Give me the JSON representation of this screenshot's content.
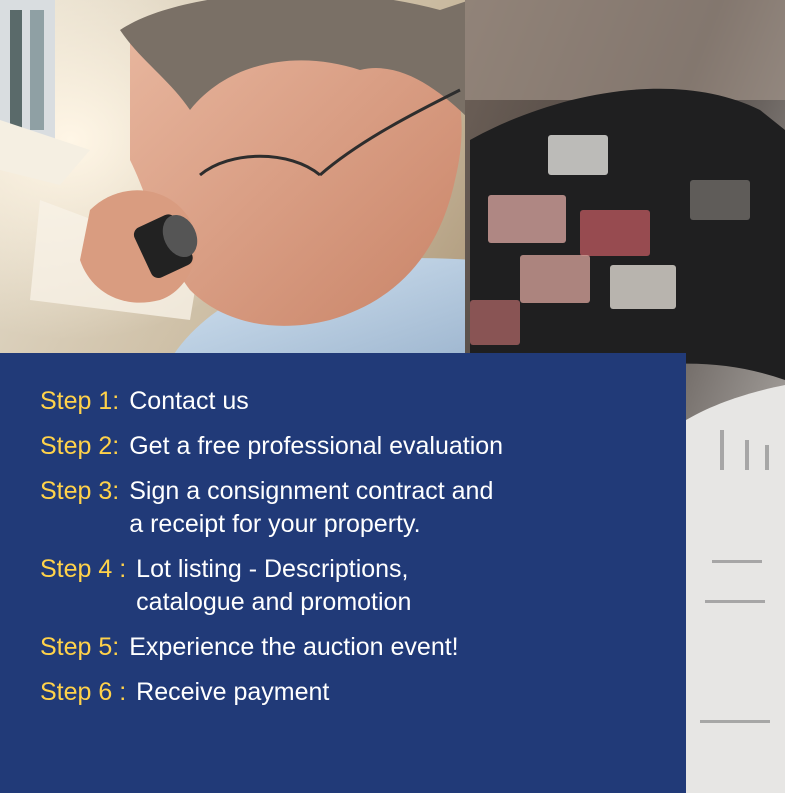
{
  "photo": {
    "left_scene": "man-examining-stamp-with-loupe",
    "right_scene": "stamp-album-pages-blurred"
  },
  "colors": {
    "panel_background": "#213a78",
    "step_label": "#ffd24a",
    "step_text": "#ffffff"
  },
  "steps": [
    {
      "label": "Step 1:",
      "text": "Contact us"
    },
    {
      "label": "Step 2:",
      "text": "Get a free professional evaluation"
    },
    {
      "label": "Step 3:",
      "text": "Sign a consignment contract and\na receipt for your property."
    },
    {
      "label": "Step 4 :",
      "text": "Lot listing - Descriptions,\ncatalogue and promotion"
    },
    {
      "label": "Step 5:",
      "text": "Experience the auction event!"
    },
    {
      "label": "Step 6 :",
      "text": "Receive payment"
    }
  ]
}
